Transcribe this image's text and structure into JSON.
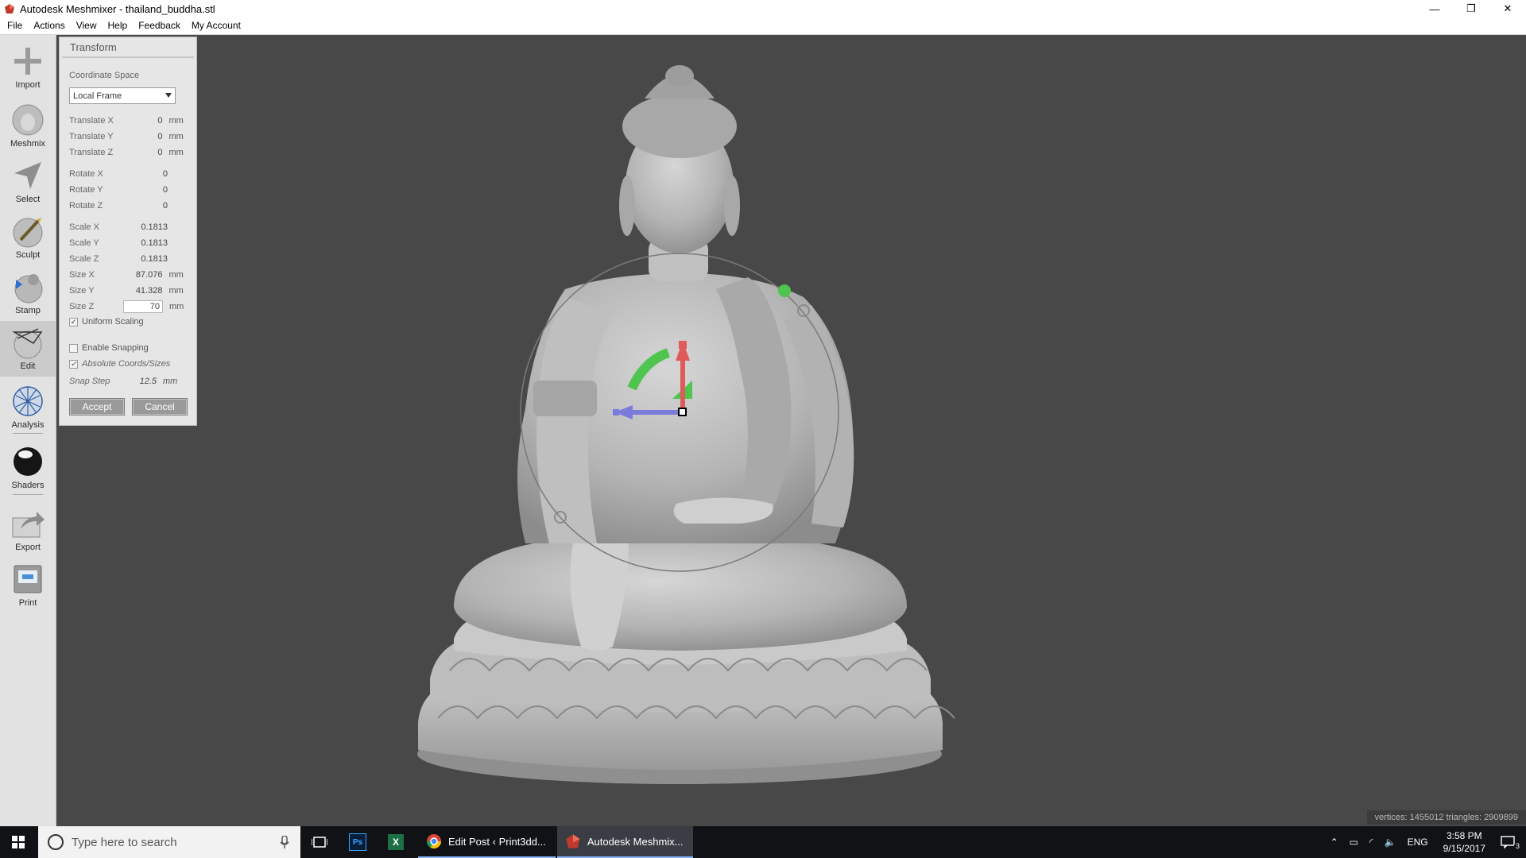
{
  "window": {
    "title": "Autodesk Meshmixer - thailand_buddha.stl",
    "controls": [
      "—",
      "❐",
      "✕"
    ]
  },
  "menu": [
    "File",
    "Actions",
    "View",
    "Help",
    "Feedback",
    "My Account"
  ],
  "toolbar": [
    {
      "label": "Import",
      "icon": "plus-icon"
    },
    {
      "label": "Meshmix",
      "icon": "meshmix-head-icon"
    },
    {
      "label": "Select",
      "icon": "select-arrow-icon"
    },
    {
      "label": "Sculpt",
      "icon": "brush-icon"
    },
    {
      "label": "Stamp",
      "icon": "stamp-icon"
    },
    {
      "label": "Edit",
      "icon": "edit-mesh-icon"
    },
    {
      "label": "Analysis",
      "icon": "analysis-sphere-icon"
    },
    {
      "label": "Shaders",
      "icon": "shader-sphere-icon"
    },
    {
      "label": "Export",
      "icon": "export-icon"
    },
    {
      "label": "Print",
      "icon": "printer-icon"
    }
  ],
  "transform": {
    "title": "Transform",
    "coordinate_space_label": "Coordinate Space",
    "coordinate_space_value": "Local Frame",
    "unit": "mm",
    "translate": [
      {
        "label": "Translate X",
        "value": "0"
      },
      {
        "label": "Translate Y",
        "value": "0"
      },
      {
        "label": "Translate Z",
        "value": "0"
      }
    ],
    "rotate": [
      {
        "label": "Rotate X",
        "value": "0"
      },
      {
        "label": "Rotate Y",
        "value": "0"
      },
      {
        "label": "Rotate Z",
        "value": "0"
      }
    ],
    "scale": [
      {
        "label": "Scale X",
        "value": "0.1813"
      },
      {
        "label": "Scale Y",
        "value": "0.1813"
      },
      {
        "label": "Scale Z",
        "value": "0.1813"
      }
    ],
    "size": [
      {
        "label": "Size X",
        "value": "87.076"
      },
      {
        "label": "Size Y",
        "value": "41.328"
      },
      {
        "label": "Size Z",
        "value": "70"
      }
    ],
    "uniform_scaling_label": "Uniform Scaling",
    "uniform_scaling_checked": true,
    "enable_snapping_label": "Enable Snapping",
    "enable_snapping_checked": false,
    "absolute_coords_label": "Absolute Coords/Sizes",
    "absolute_coords_checked": true,
    "snap_step_label": "Snap Step",
    "snap_step_value": "12.5",
    "accept_label": "Accept",
    "cancel_label": "Cancel"
  },
  "status": {
    "text": "vertices: 1455012 triangles: 2909899"
  },
  "taskbar": {
    "search_placeholder": "Type here to search",
    "pinned": [
      "task-view-icon",
      "photoshop-icon",
      "excel-icon"
    ],
    "ps_label": "Ps",
    "excel_label": "X",
    "apps": [
      {
        "label": "Edit Post ‹ Print3dd...",
        "icon": "chrome-icon"
      },
      {
        "label": "Autodesk Meshmix...",
        "icon": "meshmixer-icon"
      }
    ],
    "language": "ENG",
    "time": "3:58 PM",
    "date": "9/15/2017",
    "notifications": "3"
  },
  "colors": {
    "viewport_bg": "#484848",
    "model_fill": "#b9b9b9",
    "gizmo_red": "#e05a5a",
    "gizmo_green": "#4fc44f",
    "gizmo_blue": "#7b7bdc"
  }
}
